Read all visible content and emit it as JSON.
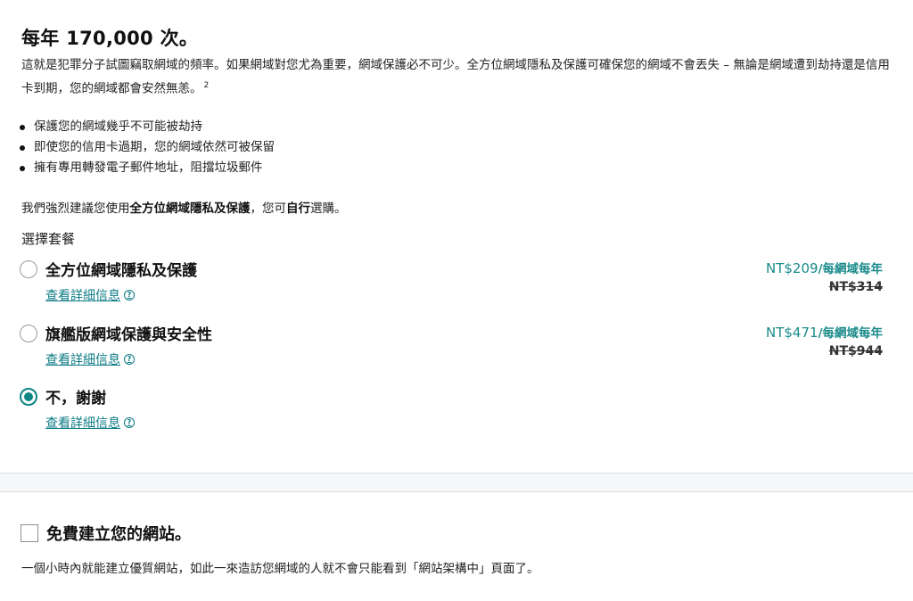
{
  "headline": "每年 170,000 次。",
  "description": "這就是犯罪分子試圖竊取網域的頻率。如果網域對您尤為重要，網域保護必不可少。全方位網域隱私及保護可確保您的網域不會丟失 – 無論是網域遭到劫持還是信用卡到期，您的網域都會安然無恙。",
  "footnote": "2",
  "bullets": [
    "保護您的網域幾乎不可能被劫持",
    "即使您的信用卡過期，您的網域依然可被保留",
    "擁有專用轉發電子郵件地址，阻擋垃圾郵件"
  ],
  "recommend": {
    "prefix": "我們強烈建議您使用",
    "product": "全方位網域隱私及保護",
    "middle": "，您可",
    "emphasis": "自行",
    "suffix": "選購。"
  },
  "plan_heading": "選擇套餐",
  "plans": [
    {
      "title": "全方位網域隱私及保護",
      "details": "查看詳細信息",
      "price": "NT$209",
      "per": "/每網域每年",
      "old_price": "NT$314",
      "selected": false
    },
    {
      "title": "旗艦版網域保護與安全性",
      "details": "查看詳細信息",
      "price": "NT$471",
      "per": "/每網域每年",
      "old_price": "NT$944",
      "selected": false
    },
    {
      "title": "不，謝謝",
      "details": "查看詳細信息",
      "selected": true
    }
  ],
  "website": {
    "title": "免費建立您的網站。",
    "description": "一個小時內就能建立優質網站，如此一來造訪您網域的人就不會只能看到「網站架構中」頁面了。",
    "checked": false
  },
  "colors": {
    "accent": "#0c8584",
    "link": "#0c7b85",
    "price": "#1a8a8a"
  }
}
